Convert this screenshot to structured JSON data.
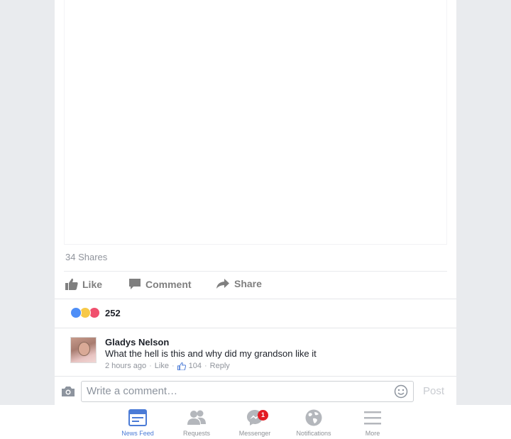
{
  "post": {
    "shares_text": "34 Shares",
    "actions": {
      "like": "Like",
      "comment": "Comment",
      "share": "Share"
    },
    "reactions": {
      "types": [
        "like-reaction-icon",
        "haha-reaction-icon",
        "love-reaction-icon"
      ],
      "count": "252"
    }
  },
  "comment": {
    "author": "Gladys Nelson",
    "text": "What the hell is this and why did my grandson like it",
    "time": "2 hours ago",
    "like_label": "Like",
    "like_count": "104",
    "reply_label": "Reply"
  },
  "composer": {
    "placeholder": "Write a comment…",
    "post_label": "Post"
  },
  "tabbar": {
    "news_feed": "News Feed",
    "requests": "Requests",
    "messenger": "Messenger",
    "messenger_badge": "1",
    "notifications": "Notifications",
    "more": "More"
  },
  "colors": {
    "accent": "#4b7bd6",
    "badge": "#e31c23",
    "background": "#e9ebee"
  }
}
